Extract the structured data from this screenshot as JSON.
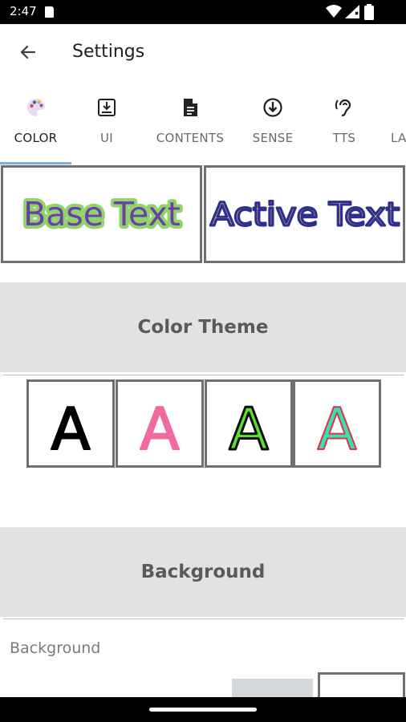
{
  "status_bar": {
    "time": "2:47",
    "icons": [
      "sd-card-icon",
      "wifi-icon",
      "signal-icon",
      "battery-icon"
    ]
  },
  "app_bar": {
    "title": "Settings",
    "back_icon": "arrow-back-icon"
  },
  "tabs": [
    {
      "label": "COLOR",
      "icon": "palette-icon",
      "active": true
    },
    {
      "label": "UI",
      "icon": "download-box-icon",
      "active": false
    },
    {
      "label": "CONTENTS",
      "icon": "document-icon",
      "active": false
    },
    {
      "label": "SENSE",
      "icon": "arrow-circle-down-icon",
      "active": false
    },
    {
      "label": "TTS",
      "icon": "hearing-icon",
      "active": false
    },
    {
      "label": "LA",
      "icon": "",
      "active": false
    }
  ],
  "preview": {
    "base_text": "Base Text",
    "active_text": "Active Text",
    "base_fill": "#6b3fa8",
    "base_stroke": "#8fd36a",
    "active_fill": "#c8b47a",
    "active_stroke": "#2c2f8f"
  },
  "sections": {
    "color_theme": "Color Theme",
    "background": "Background"
  },
  "themes": [
    {
      "letter": "A",
      "fill": "#000000",
      "stroke": "#000000"
    },
    {
      "letter": "A",
      "fill": "#f06aa0",
      "stroke": "#f06aa0"
    },
    {
      "letter": "A",
      "fill": "#5be02c",
      "stroke": "#0a0a0a"
    },
    {
      "letter": "A",
      "fill": "#38e0b0",
      "stroke": "#e0304a"
    }
  ],
  "background": {
    "label": "Background"
  }
}
